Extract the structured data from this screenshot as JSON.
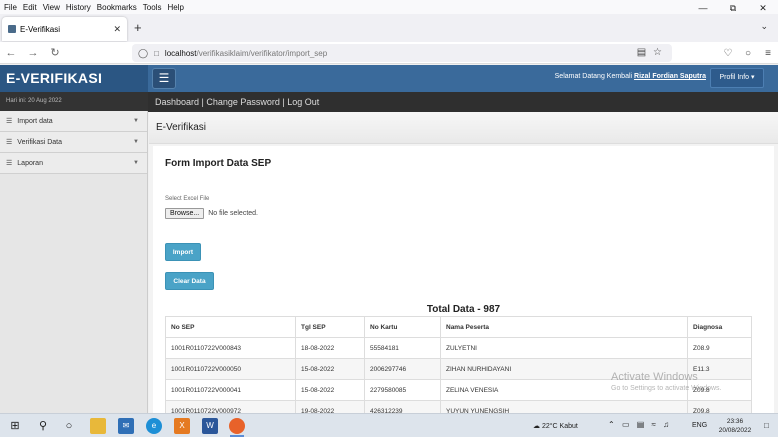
{
  "browser": {
    "menu": [
      "File",
      "Edit",
      "View",
      "History",
      "Bookmarks",
      "Tools",
      "Help"
    ],
    "tab_title": "E-Verifikasi",
    "url_host": "localhost",
    "url_path": "/verifikasiklaim/verifikator/import_sep"
  },
  "header": {
    "brand": "E-VERIFIKASI",
    "welcome_text": "Selamat Datang Kembali",
    "user_name": "Rizal Fordian Saputra",
    "profile_button": "Profil Info"
  },
  "date_label": "Hari ini: 20 Aug 2022",
  "breadcrumb": {
    "dashboard": "Dashboard",
    "change_password": "Change Password",
    "logout": "Log Out"
  },
  "sidebar": {
    "items": [
      {
        "label": "Import data"
      },
      {
        "label": "Verifikasi Data"
      },
      {
        "label": "Laporan"
      }
    ]
  },
  "main": {
    "page_header": "E-Verifikasi",
    "form_title": "Form Import Data SEP",
    "file_label": "Select Excel File",
    "browse_label": "Browse...",
    "file_status": "No file selected.",
    "import_button": "Import",
    "clear_button": "Clear Data",
    "total_label": "Total Data - 987"
  },
  "table": {
    "headers": [
      "No SEP",
      "Tgl SEP",
      "No Kartu",
      "Nama Peserta",
      "Diagnosa"
    ],
    "rows": [
      [
        "1001R0110722V000843",
        "18-08-2022",
        "55584181",
        "ZULYETNI",
        "Z08.9"
      ],
      [
        "1001R0110722V000050",
        "15-08-2022",
        "2006297746",
        "ZIHAN NURHIDAYANI",
        "E11.3"
      ],
      [
        "1001R0110722V000041",
        "15-08-2022",
        "2279580085",
        "ZELINA VENESIA",
        "Z09.8"
      ],
      [
        "1001R0110722V000972",
        "19-08-2022",
        "426312239",
        "YUYUN YUNENGSIH",
        "Z09.8"
      ]
    ]
  },
  "watermark": {
    "line1": "Activate Windows",
    "line2": "Go to Settings to activate Windows."
  },
  "taskbar": {
    "weather": "22°C  Kabut",
    "language": "ENG",
    "time": "23:36",
    "date": "20/08/2022"
  }
}
